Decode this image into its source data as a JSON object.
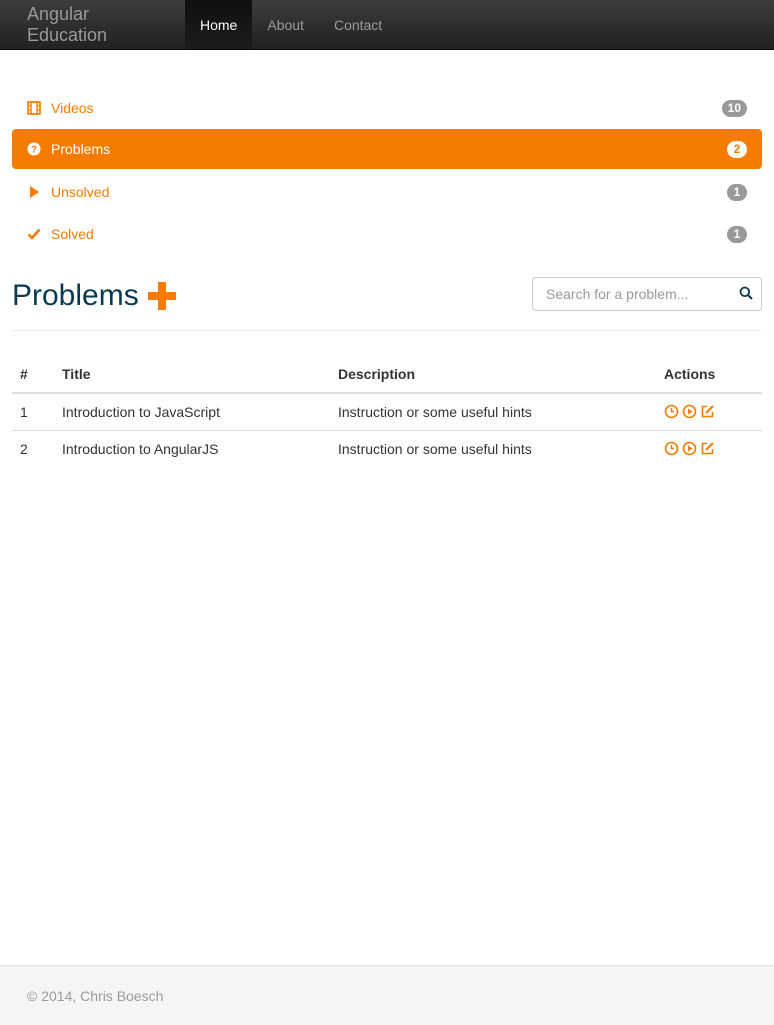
{
  "navbar": {
    "brand": "Angular Education",
    "links": [
      {
        "label": "Home",
        "active": true
      },
      {
        "label": "About",
        "active": false
      },
      {
        "label": "Contact",
        "active": false
      }
    ]
  },
  "sidebar": {
    "items": [
      {
        "label": "Videos",
        "icon": "film-icon",
        "count": "10",
        "active": false
      },
      {
        "label": "Problems",
        "icon": "question-circle-icon",
        "count": "2",
        "active": true
      },
      {
        "label": "Unsolved",
        "icon": "play-icon",
        "count": "1",
        "active": false
      },
      {
        "label": "Solved",
        "icon": "check-icon",
        "count": "1",
        "active": false
      }
    ]
  },
  "header": {
    "title": "Problems",
    "search_placeholder": "Search for a problem..."
  },
  "table": {
    "columns": [
      "#",
      "Title",
      "Description",
      "Actions"
    ],
    "rows": [
      {
        "num": "1",
        "title": "Introduction to JavaScript",
        "description": "Instruction or some useful hints"
      },
      {
        "num": "2",
        "title": "Introduction to AngularJS",
        "description": "Instruction or some useful hints"
      }
    ]
  },
  "footer": {
    "text": "© 2014, Chris Boesch"
  },
  "colors": {
    "accent": "#f57c00",
    "title": "#0a3a52",
    "badge": "#999999"
  }
}
